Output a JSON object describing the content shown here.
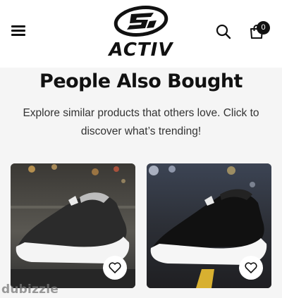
{
  "header": {
    "brand": "ACTIV",
    "cart_count": "0"
  },
  "section": {
    "title": "People Also Bought",
    "subtitle": "Explore similar products that others love. Click to discover what’s trending!"
  },
  "products": [
    {
      "image": "grey-knit-slip-on-sneaker-photo",
      "wishlist_icon": "heart-icon"
    },
    {
      "image": "black-speckled-knit-slip-on-sneaker-photo",
      "wishlist_icon": "heart-icon"
    }
  ],
  "watermark": "dubizzle",
  "icons": [
    "menu-icon",
    "search-icon",
    "cart-icon",
    "heart-icon"
  ],
  "colors": {
    "header_bg": "#ffffff",
    "page_bg": "#f5f5f5",
    "text": "#111111",
    "badge": "#111111"
  }
}
